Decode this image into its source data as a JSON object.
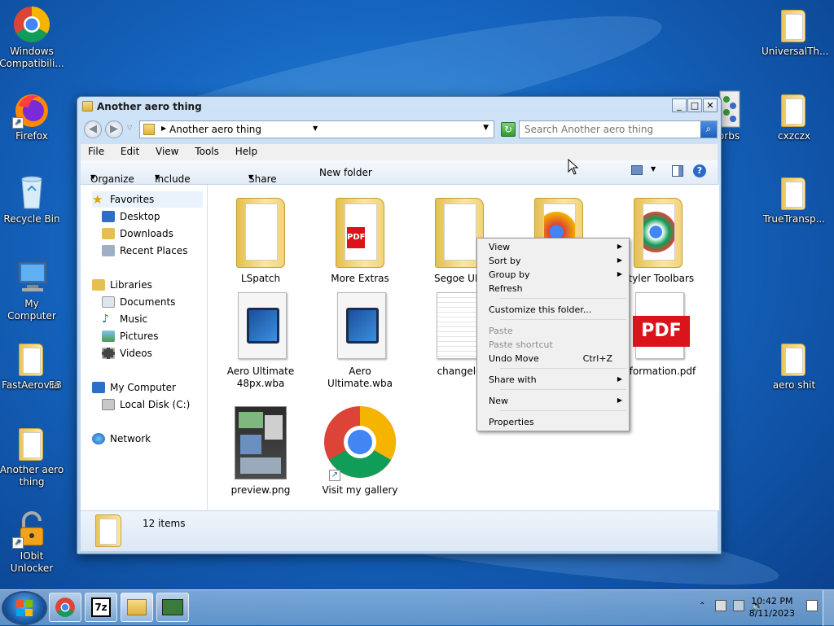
{
  "desktop": {
    "icons_left": [
      {
        "label": "Windows Compatibili...",
        "icon": "chrome-icon"
      },
      {
        "label": "Firefox",
        "icon": "firefox-icon"
      },
      {
        "label": "Recycle Bin",
        "icon": "recycle-bin-icon"
      },
      {
        "label": "My Computer",
        "icon": "computer-icon"
      },
      {
        "label": "FastAerov13",
        "icon": "folder-icon"
      },
      {
        "label": "Another aero thing",
        "icon": "folder-icon"
      },
      {
        "label": "IObit Unlocker",
        "icon": "unlocker-icon"
      }
    ],
    "icons_right": [
      {
        "label": "UniversalTh...",
        "icon": "folder-icon"
      },
      {
        "label": "cxzczx",
        "icon": "folder-icon"
      },
      {
        "label": "TrueTransp...",
        "icon": "folder-icon"
      },
      {
        "label": "aero shit",
        "icon": "folder-icon"
      }
    ],
    "partial_label_fa": "Fa",
    "partial_label_orbs": "orbs"
  },
  "window": {
    "title": "Another aero thing",
    "address": "Another aero thing",
    "search_placeholder": "Search Another aero thing",
    "menu": [
      "File",
      "Edit",
      "View",
      "Tools",
      "Help"
    ],
    "commands": [
      "Organize",
      "Include in library",
      "Share with",
      "New folder"
    ],
    "nav": {
      "favorites": "Favorites",
      "favorites_items": [
        "Desktop",
        "Downloads",
        "Recent Places"
      ],
      "libraries": "Libraries",
      "libraries_items": [
        "Documents",
        "Music",
        "Pictures",
        "Videos"
      ],
      "computer": "My Computer",
      "computer_items": [
        "Local Disk (C:)"
      ],
      "network": "Network"
    },
    "items": [
      "LSpatch",
      "More Extras",
      "Segoe UI t",
      "",
      "Styler Toolbars",
      "Aero Ultimate 48px.wba",
      "Aero Ultimate.wba",
      "changelo",
      "information.pdf",
      "preview.png",
      "Visit my gallery"
    ],
    "status": "12 items"
  },
  "context_menu": {
    "view": "View",
    "sort_by": "Sort by",
    "group_by": "Group by",
    "refresh": "Refresh",
    "customize": "Customize this folder...",
    "paste": "Paste",
    "paste_shortcut": "Paste shortcut",
    "undo_move": "Undo Move",
    "undo_shortcut": "Ctrl+Z",
    "share_with": "Share with",
    "new": "New",
    "properties": "Properties"
  },
  "taskbar": {
    "time": "10:42 PM",
    "date": "8/11/2023",
    "pinned": [
      "chrome-icon",
      "7zip-icon",
      "explorer-icon",
      "app-icon"
    ],
    "pinned_7zip_label": "7z"
  },
  "colors": {
    "accent": "#1a5fb4",
    "pdf_red": "#d9141b",
    "wallpaper": "#1565c0"
  }
}
